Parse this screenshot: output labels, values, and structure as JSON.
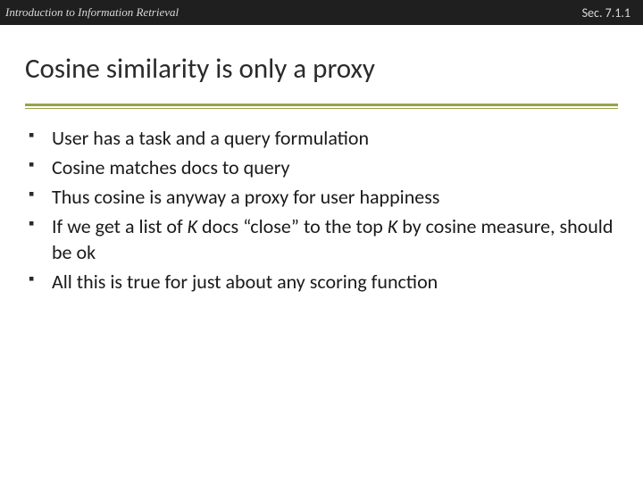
{
  "header": {
    "left": "Introduction to Information Retrieval",
    "right": "Sec. 7.1.1"
  },
  "title": "Cosine similarity is only a proxy",
  "bullets": {
    "b0": "User has a task and a query formulation",
    "b1": "Cosine matches docs to query",
    "b2": "Thus cosine is anyway a proxy for user happiness",
    "b3_a": "If we get a list of ",
    "b3_k1": "K",
    "b3_b": " docs “close” to the top ",
    "b3_k2": "K",
    "b3_c": " by cosine measure, should be ok",
    "b4": "All this is true for just about any scoring function"
  }
}
